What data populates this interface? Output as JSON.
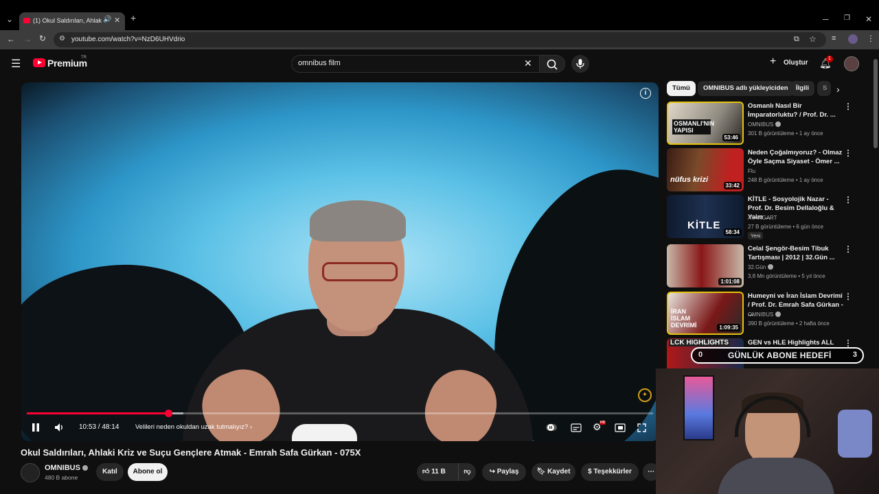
{
  "browser": {
    "tab_title": "(1) Okul Saldırıları, Ahlaki K",
    "url": "youtube.com/watch?v=NzD6UHVdrio"
  },
  "header": {
    "brand": "Premium",
    "brand_sup": "TR",
    "search_value": "omnibus film",
    "create_label": "Oluştur",
    "notif_count": "1"
  },
  "player": {
    "current_time": "10:53",
    "duration": "48:14",
    "progress_fraction": 0.2257,
    "chapter_label": "Velileri neden okuldan uzak tutmalıyız?",
    "hd_badge": "HD"
  },
  "video": {
    "title": "Okul Saldırıları, Ahlaki Kriz ve Suçu Gençlere Atmak - Emrah Safa Gürkan - 075X",
    "channel": "OMNIBUS",
    "subscribers": "480 B abone",
    "join_label": "Katıl",
    "subscribe_label": "Abone ol",
    "likes": "11 B",
    "share_label": "Paylaş",
    "save_label": "Kaydet",
    "thanks_label": "Teşekkürler"
  },
  "chips": [
    "Tümü",
    "OMNIBUS adlı yükleyiciden",
    "İlgili",
    "S"
  ],
  "recommendations": [
    {
      "title": "Osmanlı Nasıl Bir İmparatorluktu? / Prof. Dr. ...",
      "channel": "OMNIBUS",
      "meta": "301 B görüntüleme • 1 ay önce",
      "duration": "53:46",
      "thumb_text": "OSMANLI'NIN YAPISI"
    },
    {
      "title": "Neden Çoğalmıyoruz? - Olmaz Öyle Saçma Siyaset - Ömer ...",
      "channel": "Flu",
      "meta": "248 B görüntüleme • 1 ay önce",
      "duration": "33:42",
      "thumb_text": "nüfus krizi"
    },
    {
      "title": "KİTLE - Sosyolojik Nazar - Prof. Dr. Besim Dellaloğlu & Yalın ...",
      "channel": "AVANGART",
      "meta": "27 B görüntüleme • 6 gün önce",
      "duration": "58:34",
      "thumb_text": "KİTLE",
      "badge": "Yeni"
    },
    {
      "title": "Celal Şengör-Besim Tibuk Tartışması | 2012 | 32.Gün ...",
      "channel": "32.Gün",
      "meta": "3,8 Mn görüntüleme • 5 yıl önce",
      "duration": "1:01:08",
      "thumb_text": ""
    },
    {
      "title": "Humeyni ve İran İslam Devrimi / Prof. Dr. Emrah Safa Gürkan - ...",
      "channel": "OMNIBUS",
      "meta": "390 B görüntüleme • 2 hafta önce",
      "duration": "1:09:35",
      "thumb_text": "İRAN İSLAM DEVRİMİ"
    },
    {
      "title": "GEN vs HLE Highlights ALL",
      "channel": "",
      "meta": "",
      "duration": "",
      "thumb_text": "LCK HIGHLIGHTS"
    }
  ],
  "overlay": {
    "goal_left": "0",
    "goal_label": "GÜNLÜK ABONE HEDEFİ",
    "goal_right": "3"
  },
  "colors": {
    "accent": "#ff0033",
    "background": "#0f0f0f",
    "chip_bg": "#272727",
    "sponsor": "#d4a017"
  }
}
